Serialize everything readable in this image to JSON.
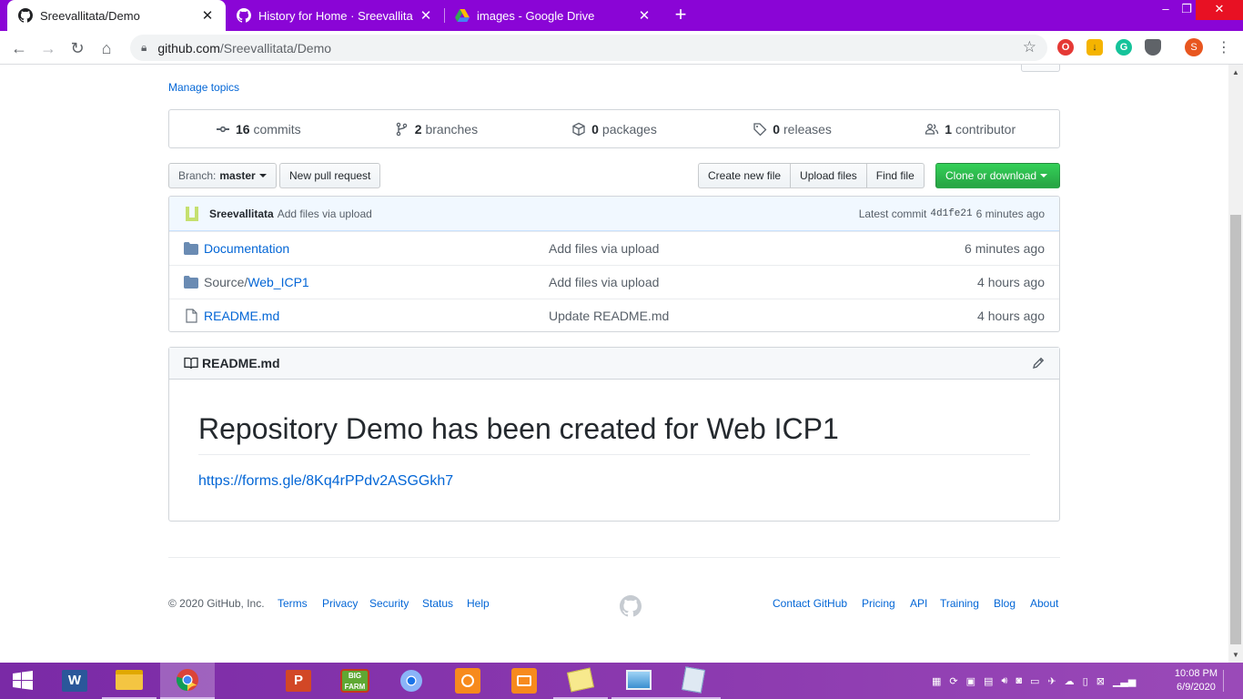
{
  "browser": {
    "tabs": [
      {
        "title": "Sreevallitata/Demo",
        "icon": "github-icon",
        "active": true
      },
      {
        "title": "History for Home · Sreevallitata/D",
        "icon": "github-icon",
        "active": false
      },
      {
        "title": "images - Google Drive",
        "icon": "google-drive-icon",
        "active": false
      }
    ],
    "url_host": "github.com",
    "url_path": "/Sreevallitata/Demo",
    "profile_initial": "S"
  },
  "repo": {
    "manage_topics": "Manage topics",
    "stats": [
      {
        "num": "16",
        "label": "commits",
        "icon": "commit-icon"
      },
      {
        "num": "2",
        "label": "branches",
        "icon": "branch-icon"
      },
      {
        "num": "0",
        "label": "packages",
        "icon": "package-icon"
      },
      {
        "num": "0",
        "label": "releases",
        "icon": "tag-icon"
      },
      {
        "num": "1",
        "label": "contributor",
        "icon": "people-icon"
      }
    ],
    "branch_prefix": "Branch:",
    "branch_name": "master",
    "new_pull_request": "New pull request",
    "create_new_file": "Create new file",
    "upload_files": "Upload files",
    "find_file": "Find file",
    "clone_or_download": "Clone or download"
  },
  "latest_commit": {
    "author": "Sreevallitata",
    "message": "Add files via upload",
    "label": "Latest commit",
    "sha": "4d1fe21",
    "age": "6 minutes ago"
  },
  "files": [
    {
      "type": "folder",
      "prefix": "",
      "name": "Documentation",
      "message": "Add files via upload",
      "age": "6 minutes ago"
    },
    {
      "type": "folder",
      "prefix": "Source/",
      "name": "Web_ICP1",
      "message": "Add files via upload",
      "age": "4 hours ago"
    },
    {
      "type": "file",
      "prefix": "",
      "name": "README.md",
      "message": "Update README.md",
      "age": "4 hours ago"
    }
  ],
  "readme": {
    "filename": "README.md",
    "heading": "Repository Demo has been created for Web ICP1",
    "link": "https://forms.gle/8Kq4rPPdv2ASGGkh7"
  },
  "footer": {
    "copyright": "© 2020 GitHub, Inc.",
    "left_links": [
      "Terms",
      "Privacy",
      "Security",
      "Status",
      "Help"
    ],
    "right_links": [
      "Contact GitHub",
      "Pricing",
      "API",
      "Training",
      "Blog",
      "About"
    ]
  },
  "taskbar": {
    "apps": [
      "word-icon",
      "file-explorer-icon",
      "chrome-icon",
      "powerpoint-icon",
      "big-farm-icon",
      "chromium-icon",
      "photo-app-icon",
      "camera-app-icon",
      "sticky-notes-icon",
      "photos-icon",
      "notepad-icon"
    ],
    "time": "10:08 PM",
    "date": "6/9/2020"
  },
  "colors": {
    "tabstrip": "#8a05d6",
    "link": "#0366d6",
    "green_button": "#28a745",
    "commit_bar": "#f1f8ff"
  }
}
